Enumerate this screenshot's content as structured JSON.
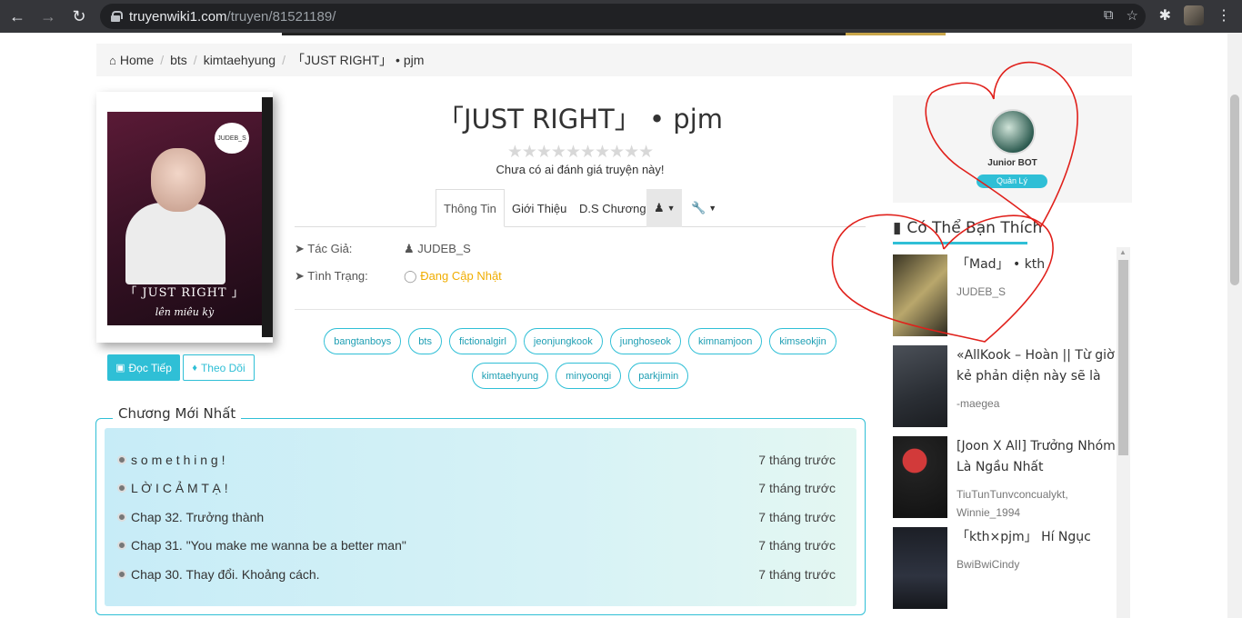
{
  "browser": {
    "url_host": "truyenwiki1.com",
    "url_path": "/truyen/81521189/"
  },
  "breadcrumb": [
    "Home",
    "bts",
    "kimtaehyung",
    "「JUST RIGHT」 • pjm"
  ],
  "story": {
    "title": "「JUST RIGHT」 • pjm",
    "cover_title": "「 JUST RIGHT 」",
    "cover_subtitle": "lên miêu kỳ",
    "cover_badge": "JUDEB_S",
    "rating_text": "Chưa có ai đánh giá truyện này!",
    "stars": 10
  },
  "buttons": {
    "read": "Đọc Tiếp",
    "follow": "Theo Dõi"
  },
  "tabs": [
    "Thông Tin",
    "Giới Thiệu",
    "D.S Chương"
  ],
  "info": {
    "author_label": "Tác Giả:",
    "author": "JUDEB_S",
    "status_label": "Tình Trạng:",
    "status": "Đang Cập Nhật"
  },
  "tags": [
    "bangtanboys",
    "bts",
    "fictionalgirl",
    "jeonjungkook",
    "junghoseok",
    "kimnamjoon",
    "kimseokjin",
    "kimtaehyung",
    "minyoongi",
    "parkjimin"
  ],
  "chapters": {
    "heading": "Chương Mới Nhất",
    "items": [
      {
        "title": "s o m e t h i n g !",
        "time": "7 tháng trước"
      },
      {
        "title": "L Ờ I C Ả M T Ạ !",
        "time": "7 tháng trước"
      },
      {
        "title": "Chap 32. Trưởng thành",
        "time": "7 tháng trước"
      },
      {
        "title": "Chap 31. \"You make me wanna be a better man\"",
        "time": "7 tháng trước"
      },
      {
        "title": "Chap 30. Thay đổi. Khoảng cách.",
        "time": "7 tháng trước"
      }
    ]
  },
  "admin": {
    "name": "Junior BOT",
    "role": "Quản Lý"
  },
  "suggestions": {
    "heading": "Có Thể Bạn Thích",
    "items": [
      {
        "title": "「Mad」 • kth",
        "author": "JUDEB_S"
      },
      {
        "title": "«AllKook – Hoàn || Từ giờ kẻ phản diện này sẽ là nhâ…",
        "author": "-maegea"
      },
      {
        "title": "[Joon X All] Trưởng Nhóm Là Ngầu Nhất",
        "author": "TiuTunTunvconcualykt, Winnie_1994"
      },
      {
        "title": "「kth×pjm」 Hí Ngục",
        "author": "BwiBwiCindy"
      }
    ]
  },
  "colors": {
    "accent": "#2fbfd6",
    "status": "#f0ad00",
    "annotation": "#e0201b"
  }
}
